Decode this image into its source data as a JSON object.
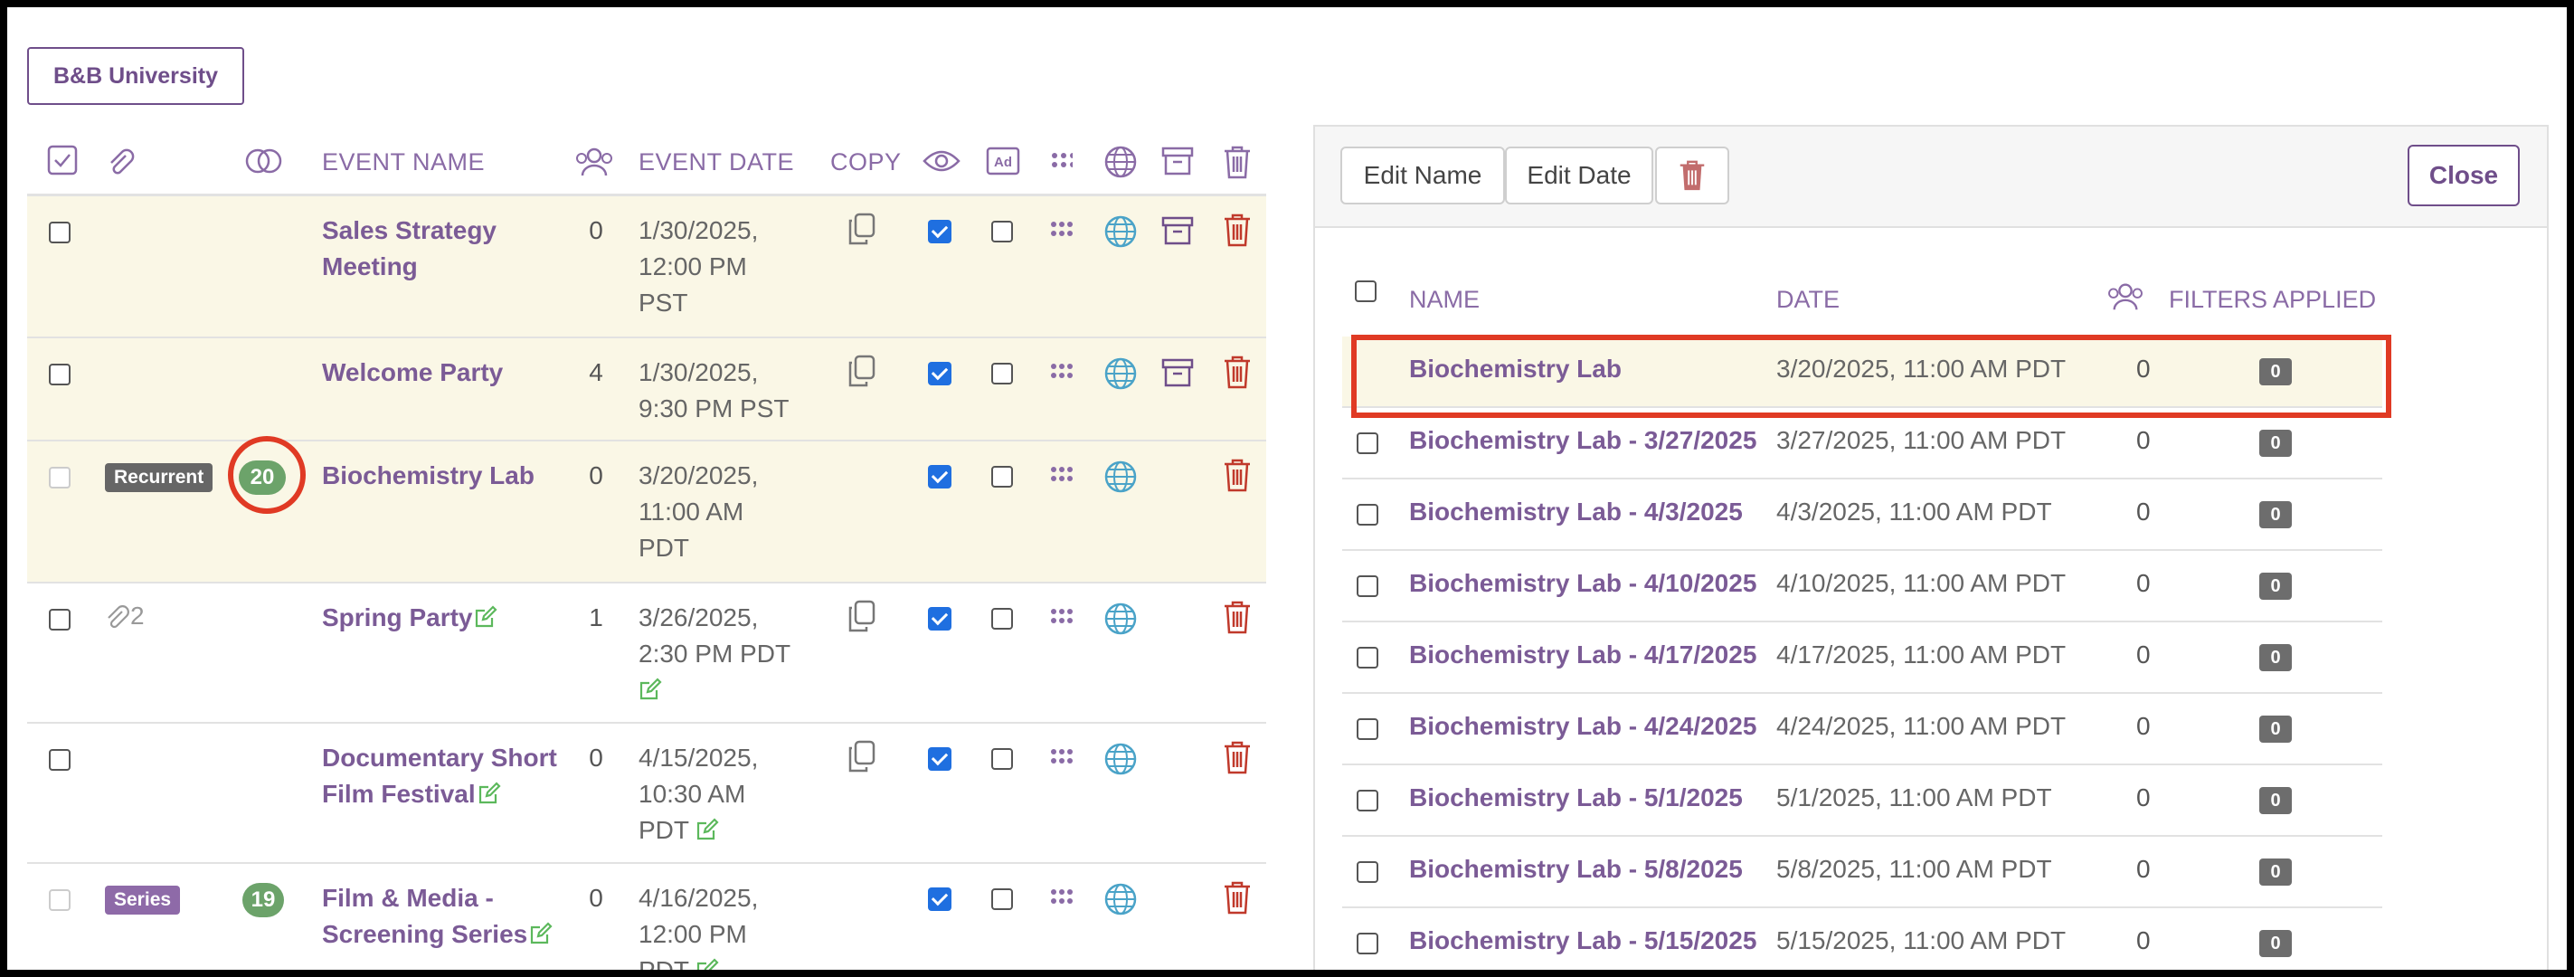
{
  "org_button": "B&B University",
  "colors": {
    "accent": "#7b5b96",
    "highlight": "#faf7e6",
    "annotation": "#e03a24",
    "delete": "#c0392b",
    "globe": "#4aa3c8"
  },
  "left_table": {
    "headers": {
      "event_name": "EVENT NAME",
      "event_date": "EVENT DATE",
      "copy": "COPY"
    },
    "rows": [
      {
        "name_l1": "Sales Strategy",
        "name_l2": "Meeting",
        "count": "0",
        "date_l1": "1/30/2025,",
        "date_l2": "12:00 PM",
        "date_l3": "PST"
      },
      {
        "name_l1": "Welcome Party",
        "count": "4",
        "date_l1": "1/30/2025,",
        "date_l2": "9:30 PM PST"
      },
      {
        "badge": "Recurrent",
        "bubble": "20",
        "name_l1": "Biochemistry Lab",
        "count": "0",
        "date_l1": "3/20/2025,",
        "date_l2": "11:00 AM",
        "date_l3": "PDT"
      },
      {
        "attach_count": "2",
        "name_l1": "Spring Party",
        "count": "1",
        "date_l1": "3/26/2025,",
        "date_l2": "2:30 PM PDT"
      },
      {
        "name_l1": "Documentary Short",
        "name_l2": "Film Festival",
        "count": "0",
        "date_l1": "4/15/2025,",
        "date_l2": "10:30 AM",
        "date_l3": "PDT"
      },
      {
        "badge": "Series",
        "bubble": "19",
        "name_l1": "Film & Media -",
        "name_l2": "Screening Series",
        "count": "0",
        "date_l1": "4/16/2025,",
        "date_l2": "12:00 PM",
        "date_l3": "PDT"
      }
    ]
  },
  "panel": {
    "edit_name": "Edit Name",
    "edit_date": "Edit Date",
    "close": "Close",
    "headers": {
      "name": "NAME",
      "date": "DATE",
      "filters": "FILTERS APPLIED"
    },
    "rows": [
      {
        "name": "Biochemistry Lab",
        "date": "3/20/2025, 11:00 AM PDT",
        "count": "0",
        "filters": "0"
      },
      {
        "name": "Biochemistry Lab - 3/27/2025",
        "date": "3/27/2025, 11:00 AM PDT",
        "count": "0",
        "filters": "0"
      },
      {
        "name": "Biochemistry Lab - 4/3/2025",
        "date": "4/3/2025, 11:00 AM PDT",
        "count": "0",
        "filters": "0"
      },
      {
        "name": "Biochemistry Lab - 4/10/2025",
        "date": "4/10/2025, 11:00 AM PDT",
        "count": "0",
        "filters": "0"
      },
      {
        "name": "Biochemistry Lab - 4/17/2025",
        "date": "4/17/2025, 11:00 AM PDT",
        "count": "0",
        "filters": "0"
      },
      {
        "name": "Biochemistry Lab - 4/24/2025",
        "date": "4/24/2025, 11:00 AM PDT",
        "count": "0",
        "filters": "0"
      },
      {
        "name": "Biochemistry Lab - 5/1/2025",
        "date": "5/1/2025, 11:00 AM PDT",
        "count": "0",
        "filters": "0"
      },
      {
        "name": "Biochemistry Lab - 5/8/2025",
        "date": "5/8/2025, 11:00 AM PDT",
        "count": "0",
        "filters": "0"
      },
      {
        "name": "Biochemistry Lab - 5/15/2025",
        "date": "5/15/2025, 11:00 AM PDT",
        "count": "0",
        "filters": "0"
      }
    ]
  }
}
